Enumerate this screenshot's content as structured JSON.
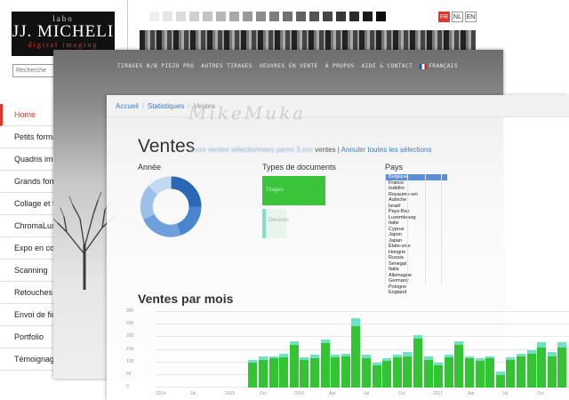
{
  "back_site": {
    "logo": {
      "top": "labo",
      "main": "JJ. MICHELI",
      "sub": "digital imaging"
    },
    "search": {
      "placeholder": "Recherche"
    },
    "swatch_colors": [
      "#f0f0f0",
      "#e6e6e6",
      "#dcdcdc",
      "#d0d0d0",
      "#c4c4c4",
      "#b6b6b6",
      "#a8a8a8",
      "#9a9a9a",
      "#8c8c8c",
      "#7e7e7e",
      "#707070",
      "#626262",
      "#545454",
      "#464646",
      "#383838",
      "#2a2a2a",
      "#1c1c1c",
      "#0e0e0e"
    ],
    "languages": [
      {
        "label": "FR",
        "active": true
      },
      {
        "label": "NL",
        "active": false
      },
      {
        "label": "EN",
        "active": false
      }
    ],
    "sidebar": [
      {
        "label": "Home",
        "active": true
      },
      {
        "label": "Petits formats",
        "active": false
      },
      {
        "label": "Quadris imp",
        "active": false
      },
      {
        "label": "Grands form",
        "active": false
      },
      {
        "label": "Collage et fir",
        "active": false
      },
      {
        "label": "ChromaLuxe",
        "active": false
      },
      {
        "label": "Expo en cou",
        "active": false
      },
      {
        "label": "Scanning",
        "active": false
      },
      {
        "label": "Retouches",
        "active": false
      },
      {
        "label": "Envoi de fich",
        "active": false
      },
      {
        "label": "Portfolio",
        "active": false
      },
      {
        "label": "Témoignage",
        "active": false
      }
    ]
  },
  "photo_site": {
    "nav": [
      "TIRAGES N/B PIEZO PRO",
      "AUTRES TIRAGES",
      "OEUVRES EN VENTE",
      "À PROPOS",
      "AIDE & CONTACT"
    ],
    "language": "FRANÇAIS"
  },
  "stats": {
    "breadcrumb": [
      "Accueil",
      "Statistiques",
      "Ventes"
    ],
    "watermark": "MikeMuka",
    "title": "Ventes",
    "sub_selected": "3,xxx",
    "sub_blur": "ventes sélectionnées parmi",
    "sub_total": "3,xxx",
    "sub_unit": "ventes |",
    "sub_reset": "Annuler toutes les sélections",
    "sections": {
      "year": "Année",
      "types": "Types de documents",
      "countries": "Pays"
    },
    "types": {
      "main": "Tirages",
      "small": "Oeuvres"
    },
    "countries": [
      "Belgique",
      "France",
      "Indéfini",
      "Royaume-uni",
      "Autriche",
      "Israël",
      "Pays-Bas",
      "Luxembourg",
      "Italie",
      "Cyprus",
      "Japon",
      "Japan",
      "États-unis",
      "Hongrie",
      "Russia",
      "Senegal",
      "Italia",
      "Allemagne",
      "Germany",
      "Pologne",
      "England"
    ],
    "months_title": "Ventes par mois",
    "colors": {
      "bar": "#33c433",
      "bar_cap": "#6ee3c2",
      "donut": "#3f7fcf"
    }
  },
  "chart_data": {
    "type": "bar",
    "title": "Ventes par mois",
    "ylim": [
      0,
      300
    ],
    "yticks": [
      0,
      50,
      100,
      150,
      200,
      250,
      300
    ],
    "x_tick_labels": [
      "2014",
      "Jul",
      "2015",
      "Oct",
      "2016",
      "Apr",
      "Jul",
      "Oct",
      "2017",
      "Apr",
      "Jul",
      "Oct"
    ],
    "series": [
      {
        "name": "Tirages",
        "values": [
          0,
          0,
          0,
          0,
          0,
          0,
          0,
          0,
          0,
          100,
          110,
          115,
          120,
          170,
          110,
          115,
          175,
          120,
          125,
          245,
          115,
          90,
          105,
          120,
          125,
          195,
          110,
          90,
          120,
          170,
          115,
          105,
          115,
          50,
          110,
          125,
          135,
          160,
          125,
          160
        ]
      },
      {
        "name": "Oeuvres",
        "values": [
          0,
          0,
          0,
          0,
          0,
          0,
          0,
          0,
          0,
          10,
          15,
          10,
          15,
          15,
          10,
          15,
          15,
          10,
          10,
          30,
          15,
          10,
          10,
          10,
          15,
          15,
          15,
          10,
          10,
          15,
          10,
          10,
          10,
          15,
          10,
          10,
          15,
          20,
          15,
          20
        ]
      }
    ]
  }
}
